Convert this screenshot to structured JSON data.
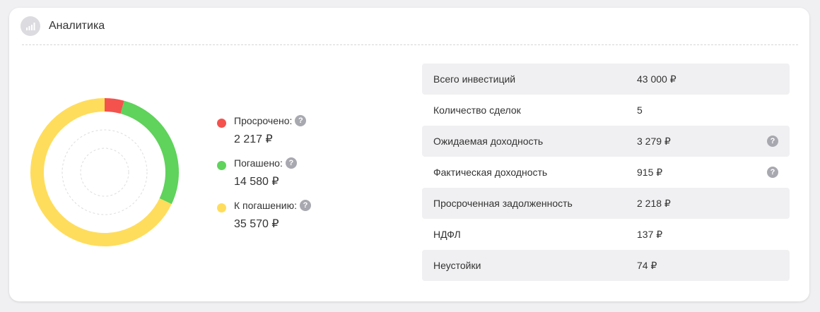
{
  "header": {
    "title": "Аналитика",
    "icon": "bar-chart-icon"
  },
  "chart_data": {
    "type": "pie",
    "variant": "donut",
    "categories": [
      "Просрочено",
      "Погашено",
      "К погашению"
    ],
    "values": [
      2217,
      14580,
      35570
    ],
    "colors": [
      "#f4524d",
      "#5fd35b",
      "#ffdd5c"
    ]
  },
  "legend": [
    {
      "label": "Просрочено:",
      "value": "2 217 ₽",
      "color": "#f4524d"
    },
    {
      "label": "Погашено:",
      "value": "14 580 ₽",
      "color": "#5fd35b"
    },
    {
      "label": "К погашению:",
      "value": "35 570 ₽",
      "color": "#ffdd5c"
    }
  ],
  "help_glyph": "?",
  "stats": [
    {
      "label": "Всего инвестиций",
      "value": "43 000 ₽",
      "help": false
    },
    {
      "label": "Количество сделок",
      "value": "5",
      "help": false
    },
    {
      "label": "Ожидаемая доходность",
      "value": "3 279 ₽",
      "help": true
    },
    {
      "label": "Фактическая доходность",
      "value": "915 ₽",
      "help": true
    },
    {
      "label": "Просроченная задолженность",
      "value": "2 218 ₽",
      "help": false
    },
    {
      "label": "НДФЛ",
      "value": "137 ₽",
      "help": false
    },
    {
      "label": "Неустойки",
      "value": "74 ₽",
      "help": false
    }
  ]
}
